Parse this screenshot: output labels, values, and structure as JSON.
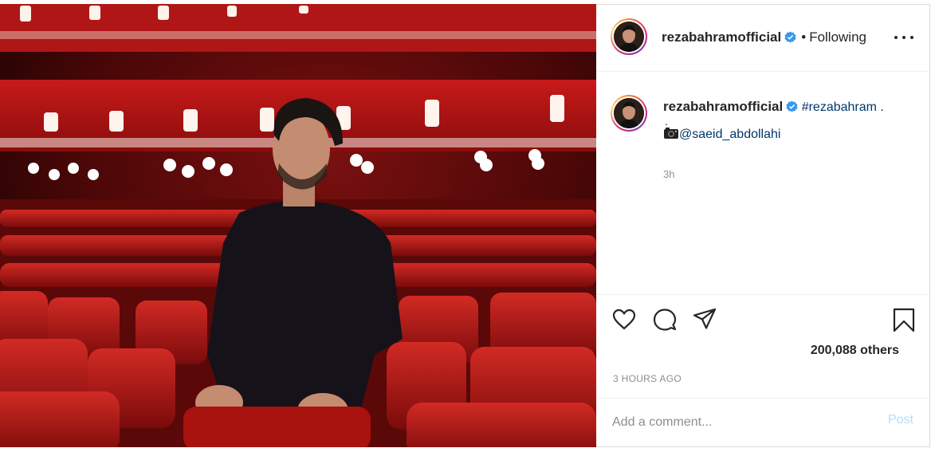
{
  "post": {
    "username": "rezabahramofficial",
    "verified": true,
    "separator": "•",
    "follow_status": "Following",
    "caption": {
      "hashtag": "#rezabahram",
      "trailing": " .",
      "line2": ".",
      "camera_icon": "camera-icon",
      "mention": "@saeid_abdollahi"
    },
    "comment_time": "3h",
    "likes": "200,088 others",
    "timestamp": "3 HOURS AGO",
    "comment_placeholder": "Add a comment...",
    "post_label": "Post"
  },
  "icons": {
    "like": "heart-icon",
    "comment": "comment-bubble-icon",
    "share": "paper-plane-icon",
    "save": "bookmark-icon",
    "more": "more-options-icon",
    "verified": "verified-badge-icon"
  },
  "colors": {
    "accent_link": "#00376b",
    "verified_blue": "#3897f0",
    "post_disabled": "#b2dffc",
    "muted": "#8e8e8e"
  }
}
